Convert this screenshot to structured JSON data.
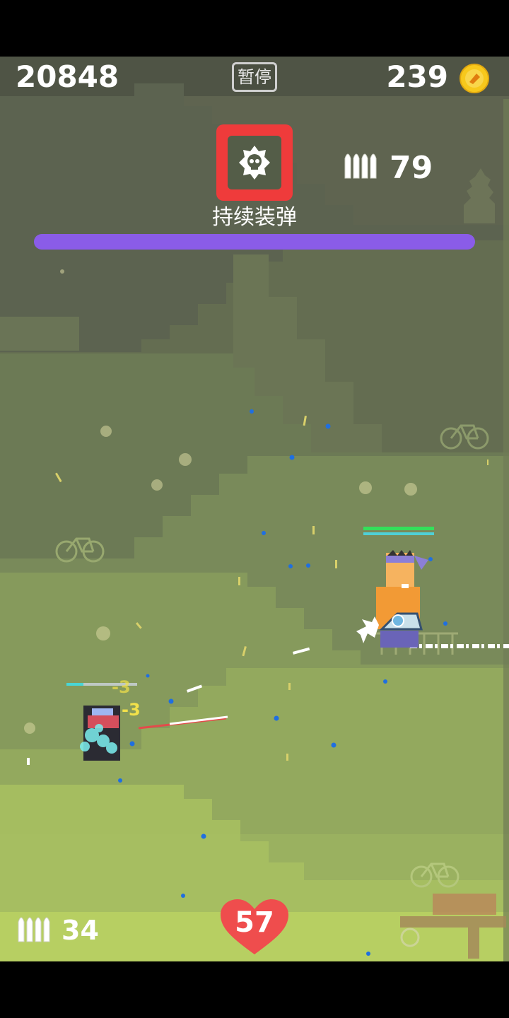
{
  "hud": {
    "score": "20848",
    "pause_label": "暂停",
    "coins": "239",
    "skill_label": "持续装弹",
    "reserve_ammo": "79",
    "ammo_count": "34",
    "hp": "57",
    "progress": 1.0
  },
  "damage_numbers": [
    "-3",
    "-3"
  ],
  "icons": {
    "coin": "coin-icon",
    "skill": "skull-badge-icon",
    "ammo": "bullets-icon",
    "hp": "heart-icon",
    "weapon": "gun-icon"
  },
  "colors": {
    "skill_frame": "#ef3b3b",
    "progress_bar": "#8a5ce8",
    "heart": "#ef4d4d",
    "coin": "#f7c81c",
    "top_bg": "#5d6150",
    "ground_light": "#b7cf62"
  }
}
